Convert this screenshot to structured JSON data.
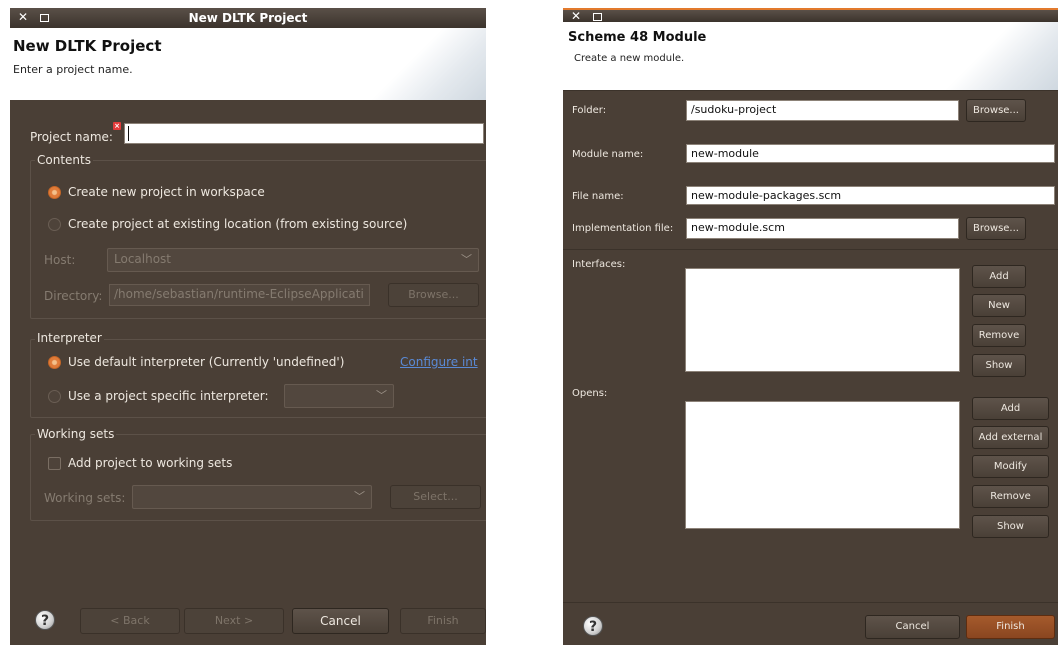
{
  "left_dialog": {
    "window_title": "New DLTK Project",
    "banner_title": "New DLTK Project",
    "banner_desc": "Enter a project name.",
    "project_name_label": "Project name:",
    "project_name_value": "",
    "contents_title": "Contents",
    "radio_workspace": "Create new project in workspace",
    "radio_existing": "Create project at existing location (from existing source)",
    "host_label": "Host:",
    "host_value": "Localhost",
    "directory_label": "Directory:",
    "directory_value": "/home/sebastian/runtime-EclipseApplicati",
    "browse_label": "Browse...",
    "interpreter_title": "Interpreter",
    "radio_default_interp": "Use default interpreter (Currently 'undefined')",
    "configure_link": "Configure int",
    "radio_specific_interp": "Use a project specific interpreter:",
    "working_sets_title": "Working sets",
    "add_to_ws_label": "Add project to working sets",
    "working_sets_label": "Working sets:",
    "select_label": "Select...",
    "back_label": "< Back",
    "next_label": "Next >",
    "cancel_label": "Cancel",
    "finish_label": "Finish"
  },
  "right_dialog": {
    "banner_title": "Scheme 48 Module",
    "banner_desc": "Create a new module.",
    "folder_label": "Folder:",
    "folder_value": "/sudoku-project",
    "browse_label": "Browse...",
    "module_name_label": "Module name:",
    "module_name_value": "new-module",
    "file_name_label": "File name:",
    "file_name_value": "new-module-packages.scm",
    "impl_file_label": "Implementation file:",
    "impl_file_value": "new-module.scm",
    "browse2_label": "Browse...",
    "interfaces_label": "Interfaces:",
    "interfaces_buttons": [
      "Add",
      "New",
      "Remove",
      "Show"
    ],
    "opens_label": "Opens:",
    "opens_buttons": [
      "Add",
      "Add external",
      "Modify",
      "Remove",
      "Show"
    ],
    "cancel_label": "Cancel",
    "finish_label": "Finish"
  },
  "colors": {
    "dialog_bg": "#4a3f36",
    "accent": "#e07b39",
    "link": "#5a8ad6"
  }
}
